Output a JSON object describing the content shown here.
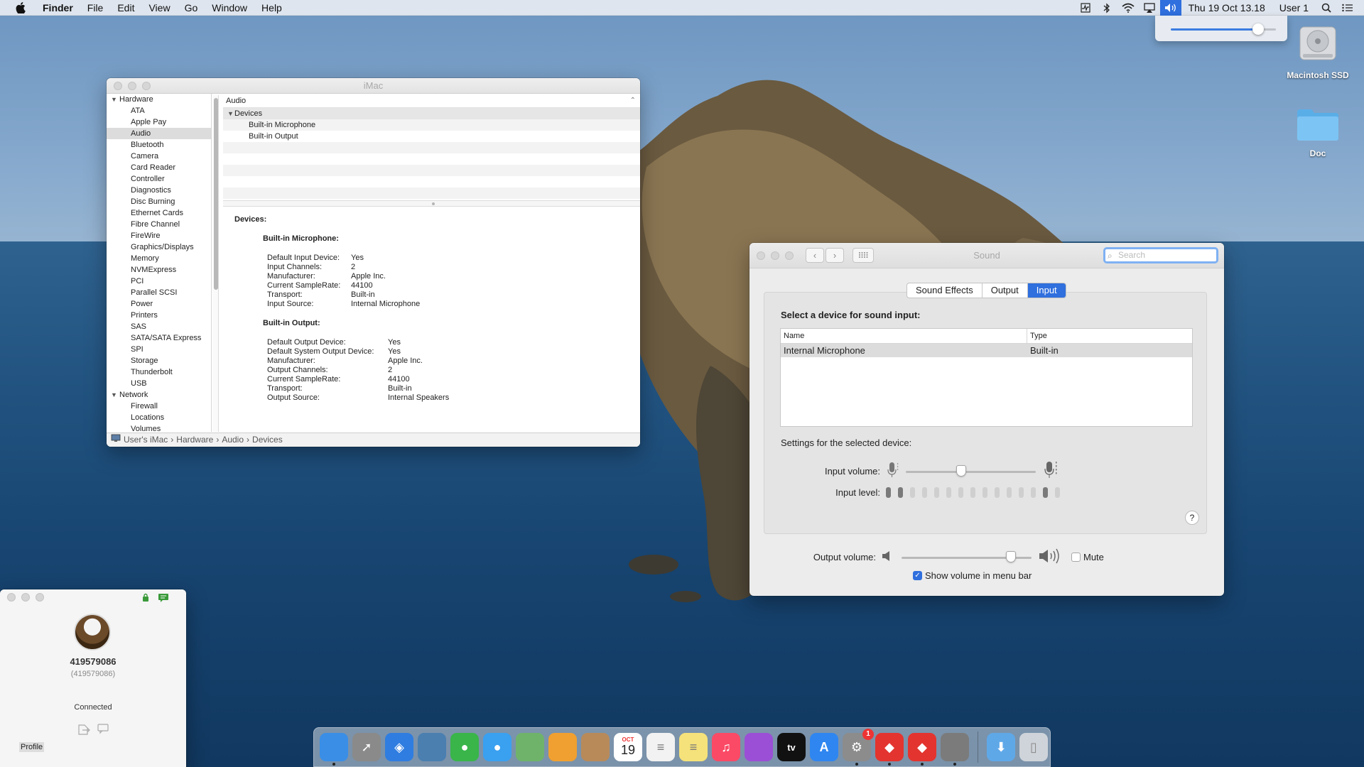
{
  "menubar": {
    "app_name": "Finder",
    "menus": [
      "File",
      "Edit",
      "View",
      "Go",
      "Window",
      "Help"
    ],
    "clock": "Thu 19 Oct  13.18",
    "user": "User 1",
    "status_icons": [
      "activity-icon",
      "bluetooth-icon",
      "wifi-icon",
      "airplay-icon",
      "volume-icon",
      "search-icon",
      "list-icon"
    ]
  },
  "volume_popup": {
    "level": 0.87
  },
  "desktop": {
    "icons": [
      {
        "label": "Macintosh SSD",
        "icon": "hard-drive-icon"
      },
      {
        "label": "Doc",
        "icon": "folder-icon"
      }
    ]
  },
  "sysinfo": {
    "title": "iMac",
    "sidebar": {
      "groups": [
        {
          "label": "Hardware",
          "items": [
            "ATA",
            "Apple Pay",
            "Audio",
            "Bluetooth",
            "Camera",
            "Card Reader",
            "Controller",
            "Diagnostics",
            "Disc Burning",
            "Ethernet Cards",
            "Fibre Channel",
            "FireWire",
            "Graphics/Displays",
            "Memory",
            "NVMExpress",
            "PCI",
            "Parallel SCSI",
            "Power",
            "Printers",
            "SAS",
            "SATA/SATA Express",
            "SPI",
            "Storage",
            "Thunderbolt",
            "USB"
          ]
        },
        {
          "label": "Network",
          "items": [
            "Firewall",
            "Locations",
            "Volumes"
          ]
        }
      ],
      "selected": "Audio"
    },
    "content_header": "Audio",
    "tree": {
      "group": "Devices",
      "children": [
        "Built-in Microphone",
        "Built-in Output"
      ]
    },
    "detail": {
      "section": "Devices:",
      "mic_title": "Built-in Microphone:",
      "mic": [
        [
          "Default Input Device:",
          "Yes"
        ],
        [
          "Input Channels:",
          "2"
        ],
        [
          "Manufacturer:",
          "Apple Inc."
        ],
        [
          "Current SampleRate:",
          "44100"
        ],
        [
          "Transport:",
          "Built-in"
        ],
        [
          "Input Source:",
          "Internal Microphone"
        ]
      ],
      "out_title": "Built-in Output:",
      "out": [
        [
          "Default Output Device:",
          "Yes"
        ],
        [
          "Default System Output Device:",
          "Yes"
        ],
        [
          "Manufacturer:",
          "Apple Inc."
        ],
        [
          "Output Channels:",
          "2"
        ],
        [
          "Current SampleRate:",
          "44100"
        ],
        [
          "Transport:",
          "Built-in"
        ],
        [
          "Output Source:",
          "Internal Speakers"
        ]
      ]
    },
    "pathbar": [
      "User's iMac",
      "Hardware",
      "Audio",
      "Devices"
    ]
  },
  "sound": {
    "title": "Sound",
    "search_placeholder": "Search",
    "tabs": [
      "Sound Effects",
      "Output",
      "Input"
    ],
    "active_tab": "Input",
    "select_label": "Select a device for sound input:",
    "table": {
      "headers": [
        "Name",
        "Type"
      ],
      "rows": [
        [
          "Internal Microphone",
          "Built-in"
        ]
      ]
    },
    "settings_label": "Settings for the selected device:",
    "input_volume_label": "Input volume:",
    "input_volume": 0.42,
    "input_level_label": "Input level:",
    "input_level_bars": 15,
    "input_level_on": [
      0,
      1,
      13
    ],
    "help": "?",
    "output_volume_label": "Output volume:",
    "output_volume": 0.87,
    "mute_label": "Mute",
    "show_volume_label": "Show volume in menu bar"
  },
  "remote": {
    "id": "419579086",
    "id_sub": "(419579086)",
    "status": "Connected",
    "profile": "Profile"
  },
  "dock": {
    "apps": [
      {
        "name": "finder-icon",
        "color": "#3a8ee6"
      },
      {
        "name": "launchpad-icon",
        "color": "#8a8a8a"
      },
      {
        "name": "safari-icon",
        "color": "#2f7de0"
      },
      {
        "name": "preview-icon",
        "color": "#4a7fb0"
      },
      {
        "name": "facetime-icon",
        "color": "#39b54a"
      },
      {
        "name": "messages-icon",
        "color": "#3aa0f0"
      },
      {
        "name": "maps-icon",
        "color": "#6fb36a"
      },
      {
        "name": "photos-icon",
        "color": "#f0a030"
      },
      {
        "name": "contacts-icon",
        "color": "#b88a5a"
      },
      {
        "name": "calendar-icon",
        "color": "#ffffff"
      },
      {
        "name": "reminders-icon",
        "color": "#f2f2f2"
      },
      {
        "name": "notes-icon",
        "color": "#f5e27a"
      },
      {
        "name": "music-icon",
        "color": "#fb4a66"
      },
      {
        "name": "podcasts-icon",
        "color": "#9b4fd6"
      },
      {
        "name": "tv-icon",
        "color": "#111111"
      },
      {
        "name": "app-store-icon",
        "color": "#2f86f0"
      },
      {
        "name": "system-preferences-icon",
        "color": "#8c8c8c"
      },
      {
        "name": "anydesk-icon",
        "color": "#e3342f"
      },
      {
        "name": "anydesk-alt-icon",
        "color": "#e3342f"
      },
      {
        "name": "automator-icon",
        "color": "#7b7b7b"
      },
      {
        "name": "downloads-folder-icon",
        "color": "#5fa8e8"
      },
      {
        "name": "trash-icon",
        "color": "#cfd4da"
      }
    ],
    "calendar_month": "OCT",
    "calendar_day": "19",
    "tv_label": "tv",
    "sysprefs_badge": "1"
  }
}
